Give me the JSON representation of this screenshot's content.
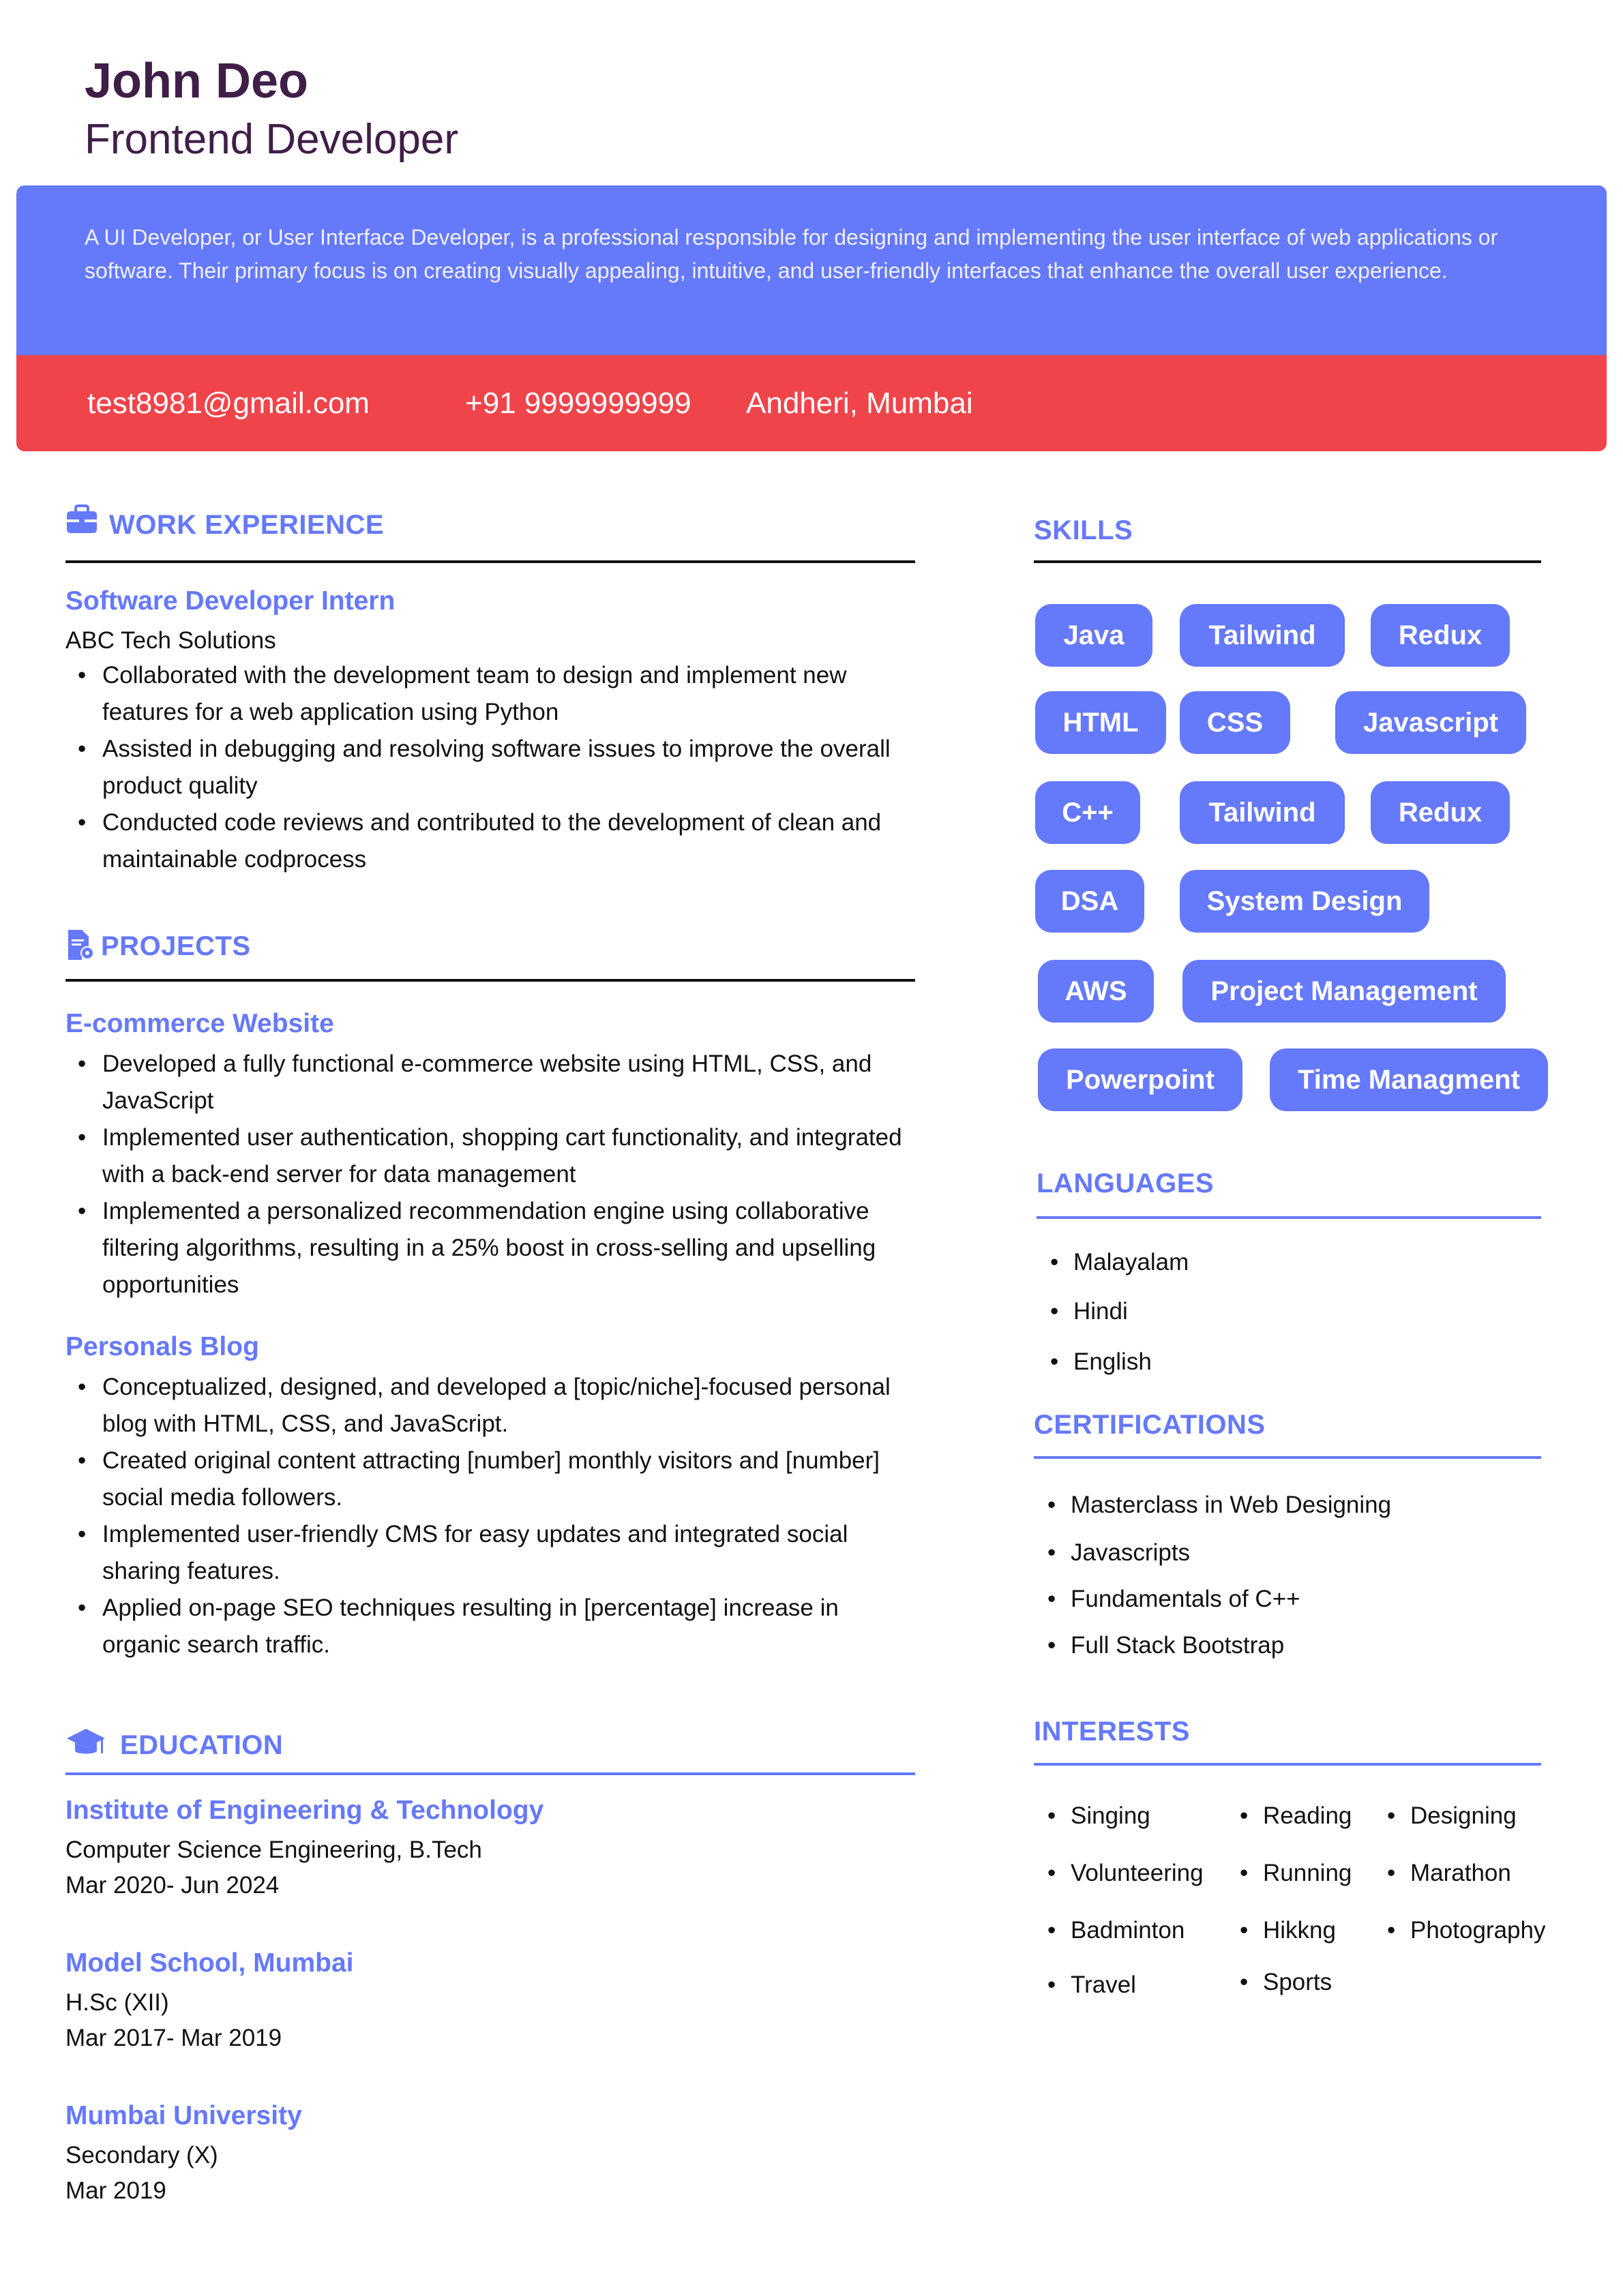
{
  "header": {
    "name": "John Deo",
    "role": "Frontend Developer",
    "summary": "A UI Developer, or User Interface Developer, is a professional responsible for designing and implementing the user interface of web applications or software. Their primary focus is on creating visually appealing, intuitive, and user-friendly interfaces that enhance the overall user experience.",
    "email": "test8981@gmail.com",
    "phone": "+91 9999999999",
    "location": "Andheri, Mumbai"
  },
  "colors": {
    "accent": "#6579fb",
    "contact_band": "#f0444b",
    "name": "#3f1e47"
  },
  "work": {
    "heading": "WORK EXPERIENCE",
    "icon": "briefcase-icon",
    "title": "Software Developer Intern",
    "company": "ABC Tech Solutions",
    "bullets": [
      [
        "Collaborated with the development team to design and implement new",
        "features for a web application using Python"
      ],
      [
        "Assisted in debugging and resolving software issues to improve the overall",
        "product quality"
      ],
      [
        "Conducted code reviews and contributed to the development of clean and",
        "maintainable codprocess"
      ]
    ]
  },
  "projects": {
    "heading": "PROJECTS",
    "icon": "document-gear-icon",
    "items": [
      {
        "title": "E-commerce Website",
        "bullets": [
          [
            "Developed a fully functional e-commerce website using HTML, CSS, and",
            "JavaScript"
          ],
          [
            "Implemented user authentication, shopping cart functionality, and integrated",
            "with a back-end server for data management"
          ],
          [
            "Implemented a personalized recommendation engine using collaborative",
            "filtering algorithms, resulting in a 25% boost in cross-selling and upselling",
            "opportunities"
          ]
        ]
      },
      {
        "title": "Personals Blog",
        "bullets": [
          [
            "Conceptualized, designed, and developed a [topic/niche]-focused personal",
            "blog with HTML, CSS, and JavaScript."
          ],
          [
            "Created original content attracting [number] monthly visitors and [number]",
            "social media followers."
          ],
          [
            "Implemented user-friendly CMS for easy updates and integrated social",
            "sharing features."
          ],
          [
            "Applied on-page SEO techniques resulting in [percentage] increase in",
            "organic search traffic."
          ]
        ]
      }
    ]
  },
  "education": {
    "heading": "EDUCATION",
    "icon": "graduation-cap-icon",
    "items": [
      {
        "institution": "Institute of Engineering & Technology",
        "degree": "Computer Science Engineering, B.Tech",
        "dates": "Mar 2020- Jun 2024"
      },
      {
        "institution": "Model School, Mumbai",
        "degree": "H.Sc (XII)",
        "dates": "Mar 2017- Mar 2019"
      },
      {
        "institution": "Mumbai University",
        "degree": "Secondary (X)",
        "dates": "Mar 2019"
      }
    ]
  },
  "skills": {
    "heading": "SKILLS",
    "items": [
      "Java",
      "Tailwind",
      "Redux",
      "HTML",
      "CSS",
      "Javascript",
      "C++",
      "Tailwind",
      "Redux",
      "DSA",
      "System Design",
      "AWS",
      "Project Management",
      "Powerpoint",
      "Time Managment"
    ]
  },
  "languages": {
    "heading": "LANGUAGES",
    "items": [
      "Malayalam",
      "Hindi",
      "English"
    ]
  },
  "certifications": {
    "heading": "CERTIFICATIONS",
    "items": [
      "Masterclass in Web Designing",
      "Javascripts",
      "Fundamentals of C++",
      "Full Stack Bootstrap"
    ]
  },
  "interests": {
    "heading": "INTERESTS",
    "items": [
      "Singing",
      "Reading",
      "Designing",
      "Volunteering",
      "Running",
      "Marathon",
      "Badminton",
      "Hikkng",
      "Photography",
      "Travel",
      "Sports"
    ]
  }
}
